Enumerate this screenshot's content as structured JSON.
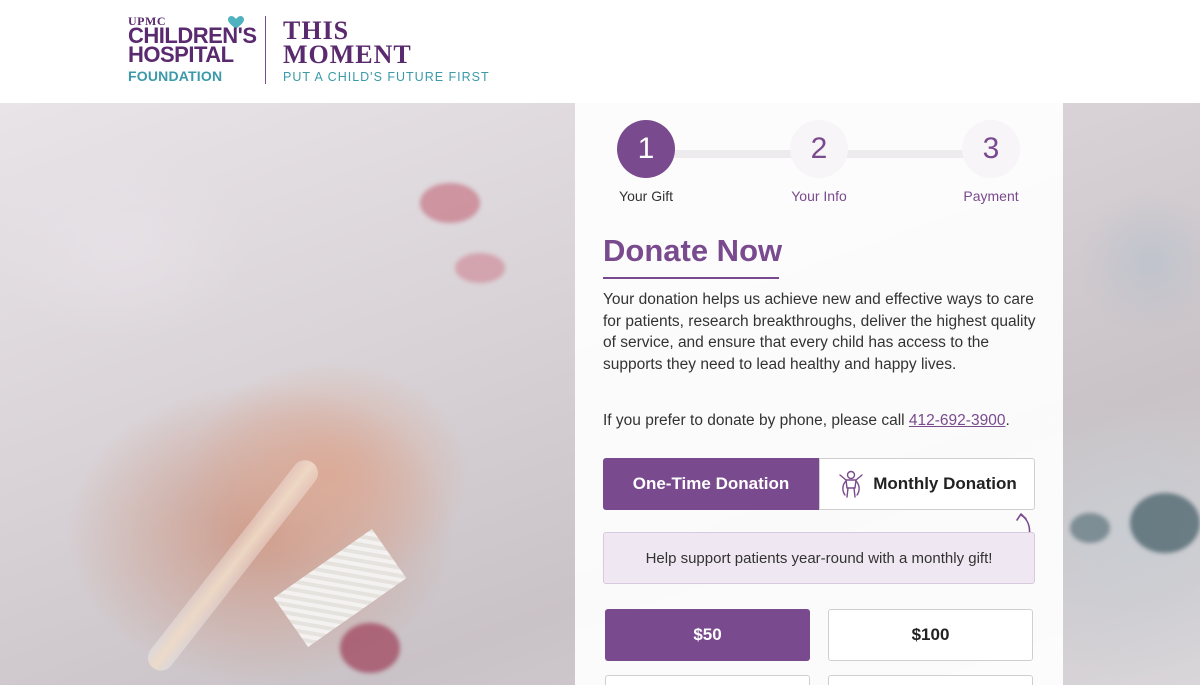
{
  "header": {
    "logo": {
      "upmc": "UPMC",
      "line1": "CHILDREN'S",
      "line2": "HOSPITAL",
      "line3": "FOUNDATION",
      "campaign_line1": "THIS",
      "campaign_line2": "MOMENT",
      "tagline": "PUT A CHILD'S FUTURE FIRST"
    }
  },
  "steps": [
    {
      "number": "1",
      "label": "Your Gift",
      "active": true
    },
    {
      "number": "2",
      "label": "Your Info",
      "active": false
    },
    {
      "number": "3",
      "label": "Payment",
      "active": false
    }
  ],
  "form": {
    "title": "Donate Now",
    "description": "Your donation helps us achieve new and effective ways to care for patients, research breakthroughs, deliver the highest quality of service, and ensure that every child has access to the supports they need to lead healthy and happy lives.",
    "phone_prefix": "If you prefer to donate by phone, please call ",
    "phone_number": "412-692-3900",
    "phone_suffix": ".",
    "tabs": {
      "one_time": "One-Time Donation",
      "monthly": "Monthly Donation"
    },
    "monthly_notice": "Help support patients year-round with a monthly gift!",
    "amounts": [
      "$50",
      "$100"
    ]
  },
  "colors": {
    "brand_purple": "#7a4a8e",
    "brand_teal": "#3a9aa8"
  }
}
